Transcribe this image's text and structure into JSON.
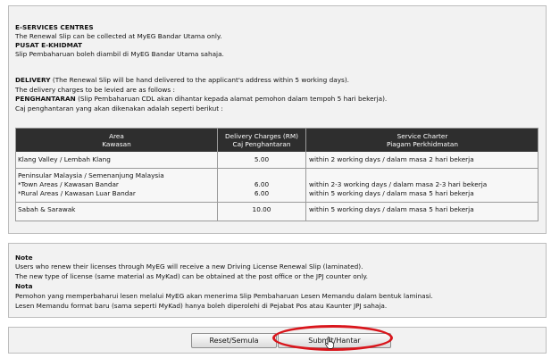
{
  "info": {
    "eservices_heading": "E-SERVICES CENTRES",
    "eservices_en": "The Renewal Slip can be collected at MyEG Bandar Utama only.",
    "eservices_bm_heading": "PUSAT E-KHIDMAT",
    "eservices_bm": "Slip Pembaharuan boleh diambil di MyEG Bandar Utama sahaja.",
    "delivery_heading": "DELIVERY",
    "delivery_en_1": "(The Renewal Slip will be hand delivered to the applicant's address within 5 working days).",
    "delivery_en_2": "The delivery charges to be levied are as follows :",
    "delivery_bm_heading": "PENGHANTARAN",
    "delivery_bm_1": "(Slip Pembaharuan CDL akan dihantar kepada alamat pemohon dalam tempoh 5 hari bekerja).",
    "delivery_bm_2": "Caj penghantaran yang akan dikenakan adalah seperti berikut :"
  },
  "table": {
    "headers": [
      {
        "en": "Area",
        "bm": "Kawasan"
      },
      {
        "en": "Delivery Charges (RM)",
        "bm": "Caj Penghantaran"
      },
      {
        "en": "Service Charter",
        "bm": "Piagam Perkhidmatan"
      }
    ],
    "rows": [
      {
        "area": "Klang Valley / Lembah Klang",
        "charge": "5.00",
        "charter": "within 2 working days / dalam masa 2 hari bekerja"
      },
      {
        "area_title": "Peninsular Malaysia / Semenanjung Malaysia",
        "sub": [
          {
            "area": "*Town Areas / Kawasan Bandar",
            "charge": "6.00",
            "charter": "within 2-3 working days / dalam masa 2-3 hari bekerja"
          },
          {
            "area": "*Rural Areas / Kawasan Luar Bandar",
            "charge": "6.00",
            "charter": "within 5 working days / dalam masa 5 hari bekerja"
          }
        ]
      },
      {
        "area": "Sabah & Sarawak",
        "charge": "10.00",
        "charter": "within 5 working days / dalam masa 5 hari bekerja"
      }
    ]
  },
  "note": {
    "heading_en": "Note",
    "en_1": "Users who renew their licenses through MyEG will receive a new Driving License Renewal Slip (laminated).",
    "en_2": "The new type of license (same material as MyKad) can be obtained at the post office or the JPJ counter only.",
    "heading_bm": "Nota",
    "bm_1": "Pemohon yang memperbaharui lesen melalui MyEG akan menerima Slip Pembaharuan Lesen Memandu dalam bentuk laminasi.",
    "bm_2": "Lesen Memandu format baru (sama seperti MyKad) hanya boleh diperolehi di Pejabat Pos atau Kaunter JPJ sahaja."
  },
  "buttons": {
    "reset": "Reset/Semula",
    "submit": "Submit/Hantar"
  },
  "colors": {
    "table_header": "#2e2e2e",
    "highlight_ring": "#d9161c"
  }
}
